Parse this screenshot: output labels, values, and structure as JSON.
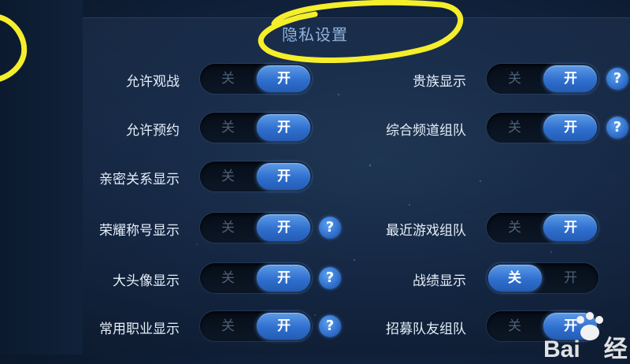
{
  "title": "隐私设置",
  "toggle_labels": {
    "off": "关",
    "on": "开"
  },
  "help_glyph": "?",
  "accent_color": "#2f6fcf",
  "highlight_color": "#f5ee2a",
  "left_column": [
    {
      "label": "允许观战",
      "state": "on",
      "help": false
    },
    {
      "label": "允许预约",
      "state": "on",
      "help": false
    },
    {
      "label": "亲密关系显示",
      "state": "on",
      "help": false
    },
    {
      "label": "荣耀称号显示",
      "state": "on",
      "help": true
    },
    {
      "label": "大头像显示",
      "state": "on",
      "help": true
    },
    {
      "label": "常用职业显示",
      "state": "on",
      "help": true
    }
  ],
  "right_column": [
    {
      "label": "贵族显示",
      "state": "on",
      "help": true
    },
    {
      "label": "综合频道组队",
      "state": "on",
      "help": true
    },
    {
      "label": "最近游戏组队",
      "state": "on",
      "help": false
    },
    {
      "label": "战绩显示",
      "state": "off",
      "help": false
    },
    {
      "label": "招募队友组队",
      "state": "on",
      "help": false
    }
  ],
  "watermark": {
    "text": "Bai",
    "suffix": "经",
    "logo": "baidu-paw-icon"
  }
}
